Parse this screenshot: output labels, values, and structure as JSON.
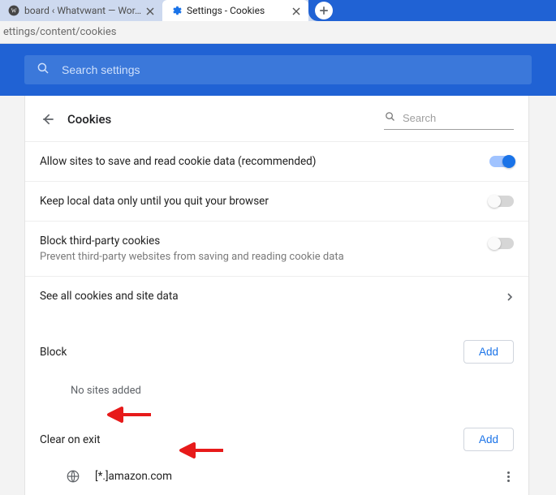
{
  "tabs": {
    "inactive": {
      "title": "board ‹ Whatvwant — Wor…"
    },
    "active": {
      "title": "Settings - Cookies"
    }
  },
  "address_bar": "ettings/content/cookies",
  "search_settings_placeholder": "Search settings",
  "page_title": "Cookies",
  "page_search_placeholder": "Search",
  "settings": {
    "allow": {
      "label": "Allow sites to save and read cookie data (recommended)",
      "on": true
    },
    "keep_local": {
      "label": "Keep local data only until you quit your browser",
      "on": false
    },
    "block_third": {
      "label": "Block third-party cookies",
      "sub": "Prevent third-party websites from saving and reading cookie data",
      "on": false
    },
    "see_all": {
      "label": "See all cookies and site data"
    }
  },
  "block_section": {
    "title": "Block",
    "add": "Add",
    "empty": "No sites added"
  },
  "clear_on_exit_section": {
    "title": "Clear on exit",
    "add": "Add",
    "sites": [
      {
        "pattern": "[*.]amazon.com"
      }
    ]
  }
}
